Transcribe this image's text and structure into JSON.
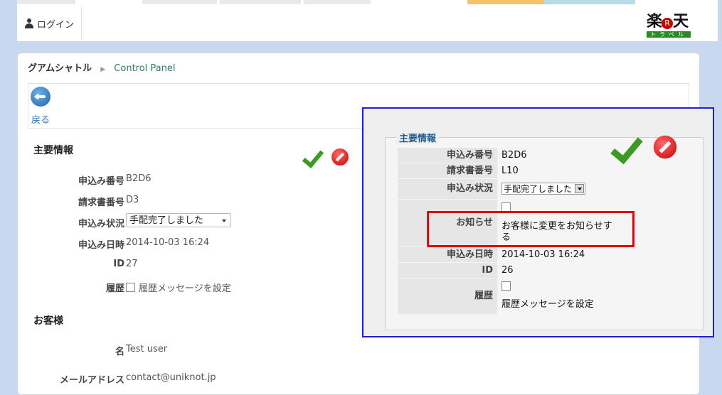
{
  "header": {
    "login_label": "ログイン",
    "logo": {
      "kanji": "楽天",
      "r": "R",
      "band": "トラベル"
    },
    "tab_colors": [
      "#e9e9e9",
      "#e9e9e9",
      "#e9e9e9",
      "#e9e9e9",
      "#f5c46a",
      "#b9dbe4"
    ]
  },
  "breadcrumb": {
    "home": "グアムシャトル",
    "current": "Control Panel"
  },
  "back": {
    "label": "戻る"
  },
  "main_info": {
    "title": "主要情報",
    "rows": [
      {
        "label": "申込み番号",
        "value": "B2D6"
      },
      {
        "label": "請求書番号",
        "value": "D3"
      },
      {
        "label": "申込み状況",
        "value": "手配完了しました"
      },
      {
        "label": "申込み日時",
        "value": "2014-10-03 16:24"
      },
      {
        "label": "ID",
        "value": "27"
      },
      {
        "label": "履歴",
        "value": "履歴メッセージを設定"
      }
    ]
  },
  "customer": {
    "title": "お客様",
    "rows": [
      {
        "label": "名",
        "value": "Test user"
      },
      {
        "label": "メールアドレス",
        "value": "contact@uniknot.jp"
      }
    ]
  },
  "zoom_panel": {
    "legend": "主要情報",
    "rows": [
      {
        "label": "申込み番号",
        "value": "B2D6"
      },
      {
        "label": "請求書番号",
        "value": "L10"
      },
      {
        "label": "申込み状況",
        "value": "手配完了しました"
      },
      {
        "label": "お知らせ",
        "value": "お客様に変更をお知らせする",
        "line1": "お客様に変更をお知らせす",
        "line2": "る"
      },
      {
        "label": "申込み日時",
        "value": "2014-10-03 16:24"
      },
      {
        "label": "ID",
        "value": "26"
      },
      {
        "label": "履歴",
        "value": "履歴メッセージを設定"
      }
    ]
  },
  "colors": {
    "highlight_box": "#e00000",
    "zoom_border": "#2020d0",
    "accept": "#3a9a22",
    "reject": "#c40000"
  }
}
